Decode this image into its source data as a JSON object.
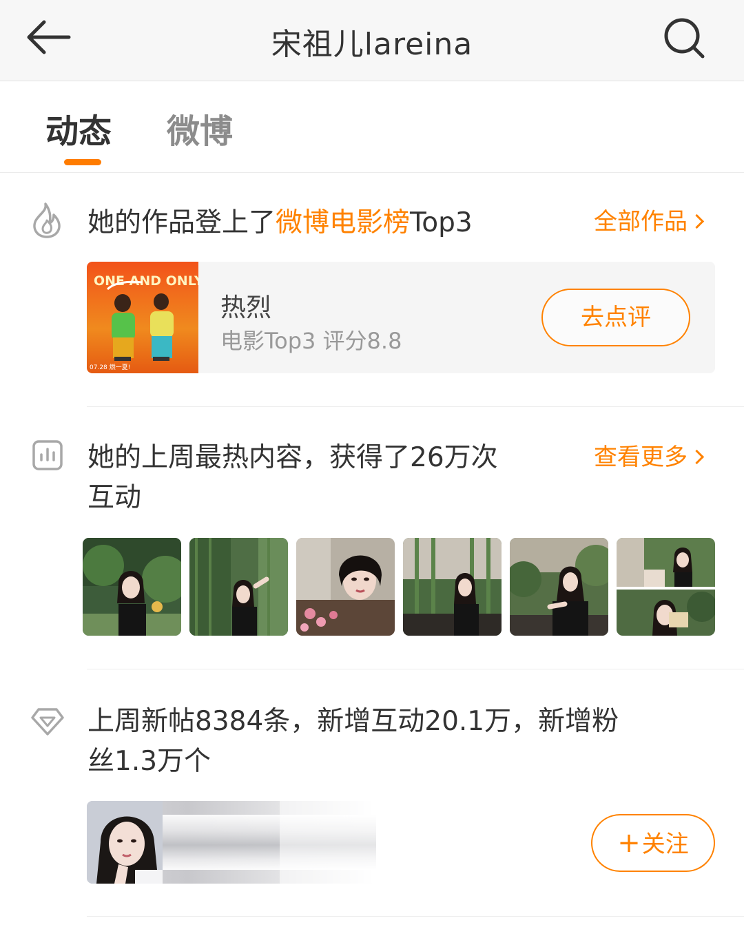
{
  "header": {
    "title": "宋祖儿lareina",
    "back_icon": "arrow-left-icon",
    "search_icon": "search-icon"
  },
  "tabs": [
    {
      "label": "动态",
      "active": true
    },
    {
      "label": "微博",
      "active": false
    }
  ],
  "colors": {
    "accent": "#ff8200",
    "text": "#333333",
    "muted": "#999999"
  },
  "movie_section": {
    "icon": "flame-icon",
    "title_prefix": "她的作品登上了",
    "title_highlight": "微博电影榜",
    "title_suffix": "Top3",
    "more_label": "全部作品",
    "movie": {
      "name": "热烈",
      "meta": "电影Top3 评分8.8",
      "button_label": "去点评",
      "poster_text": "ONE AND ONLY",
      "poster_date": "07.28 燃一夏!"
    }
  },
  "hot_section": {
    "icon": "chart-icon",
    "title_line1": "她的上周最热内容，获得了26万次",
    "title_line2": "互动",
    "more_label": "查看更多",
    "thumbnail_count": 6
  },
  "stats_section": {
    "icon": "diamond-icon",
    "title_line1": "上周新帖8384条，新增互动20.1万，新增粉",
    "title_line2": "丝1.3万个",
    "follow_label": "关注",
    "follow_plus": "+"
  }
}
